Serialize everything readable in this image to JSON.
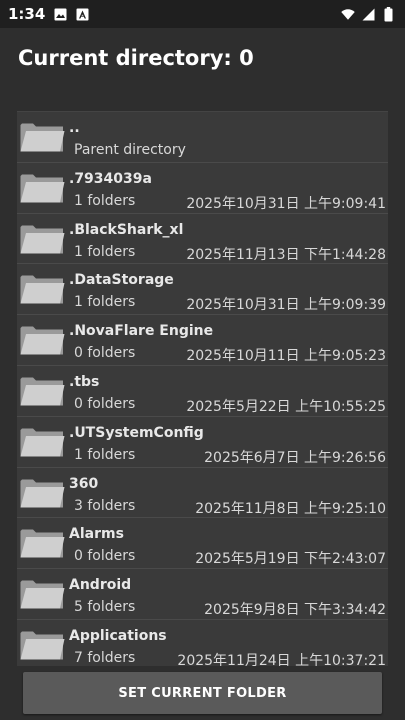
{
  "status_bar": {
    "time": "1:34",
    "icons": [
      "image-icon",
      "a-letter-icon",
      "wifi-icon",
      "signal-icon",
      "battery-icon"
    ]
  },
  "header": {
    "title": "Current directory: 0"
  },
  "parent_row": {
    "name": "..",
    "subtitle": "Parent directory"
  },
  "folders": [
    {
      "name": ".7934039a",
      "count": "1 folders",
      "date": "2025年10月31日 上午9:09:41"
    },
    {
      "name": ".BlackShark_xl",
      "count": "1 folders",
      "date": "2025年11月13日 下午1:44:28"
    },
    {
      "name": ".DataStorage",
      "count": "1 folders",
      "date": "2025年10月31日 上午9:09:39"
    },
    {
      "name": ".NovaFlare Engine",
      "count": "0 folders",
      "date": "2025年10月11日 上午9:05:23"
    },
    {
      "name": ".tbs",
      "count": "0 folders",
      "date": "2025年5月22日 上午10:55:25"
    },
    {
      "name": ".UTSystemConfig",
      "count": "1 folders",
      "date": "2025年6月7日 上午9:26:56"
    },
    {
      "name": "360",
      "count": "3 folders",
      "date": "2025年11月8日 上午9:25:10"
    },
    {
      "name": "Alarms",
      "count": "0 folders",
      "date": "2025年5月19日 下午2:43:07"
    },
    {
      "name": "Android",
      "count": "5 folders",
      "date": "2025年9月8日 下午3:34:42"
    },
    {
      "name": "Applications",
      "count": "7 folders",
      "date": "2025年11月24日 上午10:37:21"
    }
  ],
  "actions": {
    "set_current_folder": "SET CURRENT FOLDER"
  },
  "colors": {
    "background": "#2e2e2e",
    "panel": "#3a3a3a",
    "folder": "#c8c8c8",
    "button": "#5a5a5a"
  }
}
